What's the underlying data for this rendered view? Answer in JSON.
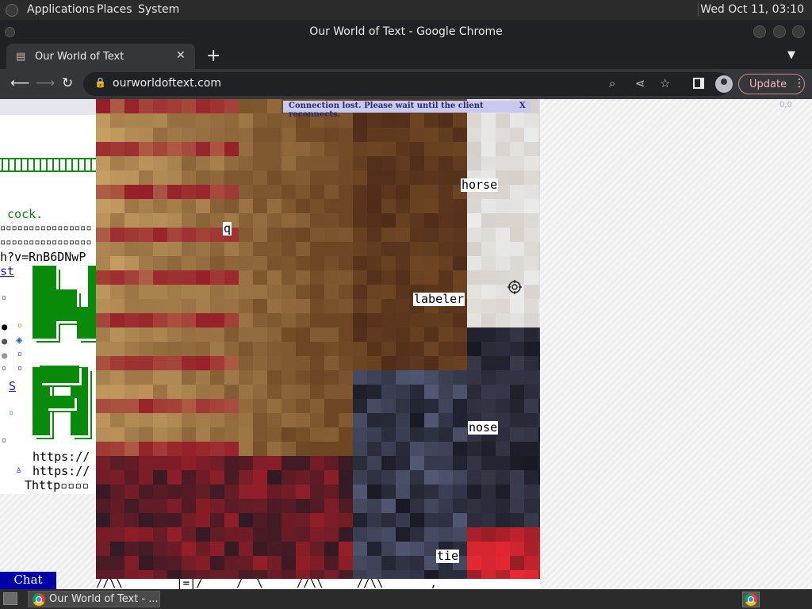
{
  "panel": {
    "menus": [
      "Applications",
      "Places",
      "System"
    ],
    "clock": "Wed Oct 11, 03:10"
  },
  "window": {
    "title": "Our World of Text - Google Chrome"
  },
  "tab": {
    "label": "Our World of Text",
    "favicon": "document-icon",
    "close": "✕",
    "new_tab": "+"
  },
  "toolbar": {
    "url": "ourworldoftext.com",
    "update_label": "Update"
  },
  "page": {
    "notice": "Connection lost. Please wait until the client reconnects.",
    "notice_close": "X",
    "chat_label": "Chat",
    "image_labels": {
      "horse": "horse",
      "q": "q",
      "labeler": "labeler",
      "nose": "nose",
      "tie": "tie"
    },
    "left_text": {
      "cock": " cock.",
      "boxes1": "▫▫▫▫▫▫▫▫▫▫▫▫▫▫▫▫",
      "boxes2": "▫▫▫▫▫▫▫▫▫▫▫▫▫▫▫▫",
      "yt": "h?v=RnB6DNwP",
      "st": "st",
      "s": "S",
      "link1": "https://",
      "link2": "https://",
      "link3": "Thttp▫▫▫▫"
    },
    "bottom_text": "//\\\\        |=|/     /  \\     //\\\\     //\\\\       ,"
  },
  "taskbar": {
    "task_label": "Our World of Text - ..."
  },
  "colors": {
    "notice_bg": "#c9c9ef",
    "chat_bg": "#0000a8",
    "accent_green": "#0a8a0a",
    "update_border": "#c58a84"
  }
}
